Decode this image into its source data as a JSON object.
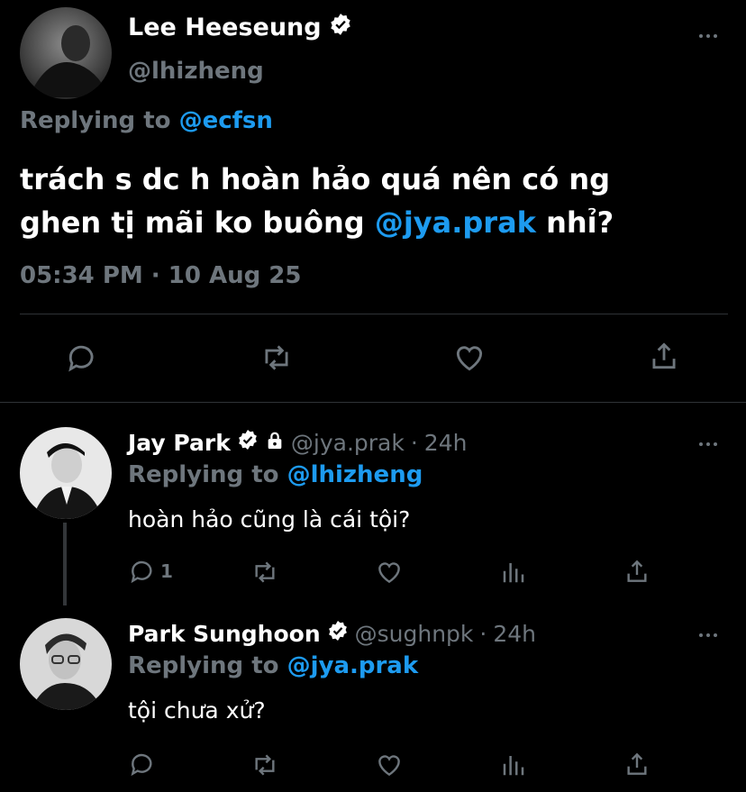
{
  "main_tweet": {
    "name": "Lee Heeseung",
    "handle": "@lhizheng",
    "replying_label": "Replying to",
    "replying_to": "@ecfsn",
    "text_line1": "trách s dc h hoàn hảo quá nên có ng",
    "text_line2_prefix": "ghen tị mãi ko buông",
    "text_mention": "@jya.prak",
    "text_line2_suffix": "nhỉ?",
    "timestamp": "05:34 PM · 10 Aug 25"
  },
  "reply1": {
    "name": "Jay Park",
    "handle": "@jya.prak",
    "separator": "·",
    "time": "24h",
    "replying_label": "Replying to",
    "replying_to": "@lhizheng",
    "text": "hoàn hảo cũng là cái tội?",
    "reply_count": "1"
  },
  "reply2": {
    "name": "Park Sunghoon",
    "handle": "@sughnpk",
    "separator": "·",
    "time": "24h",
    "replying_label": "Replying to",
    "replying_to": "@jya.prak",
    "text": "tội chưa xử?"
  },
  "colors": {
    "accent": "#1d9bf0",
    "muted": "#6e767d",
    "background": "#000000",
    "text": "#ffffff"
  }
}
